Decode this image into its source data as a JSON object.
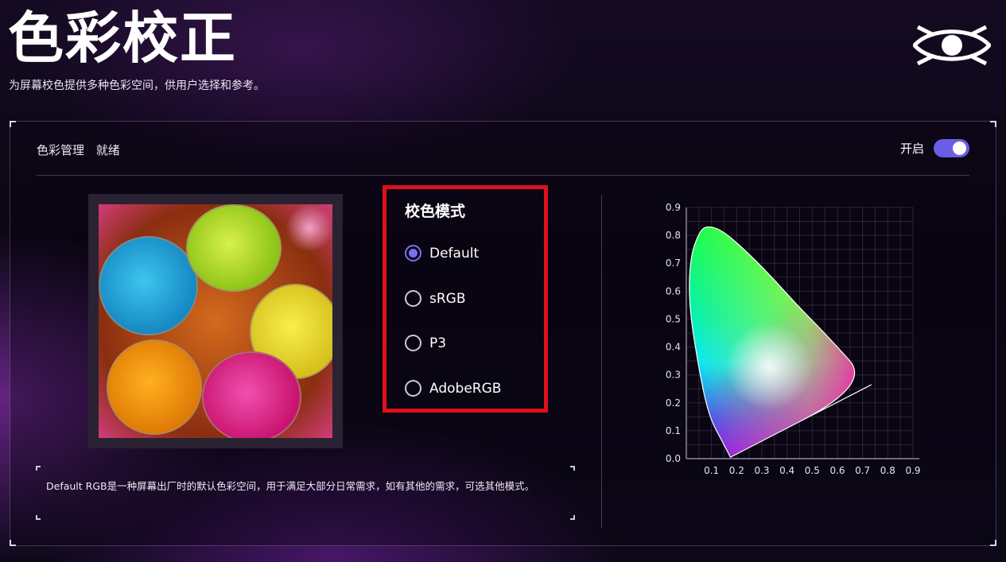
{
  "header": {
    "title": "色彩校正",
    "subtitle": "为屏幕校色提供多种色彩空间，供用户选择和参考。",
    "logo_icon": "eye-logo-icon"
  },
  "panel": {
    "status_label": "色彩管理",
    "status_value": "就绪",
    "toggle_label": "开启",
    "toggle_on": true,
    "accent_color": "#6b5ee6"
  },
  "mode": {
    "title": "校色模式",
    "options": [
      {
        "label": "Default",
        "selected": true
      },
      {
        "label": "sRGB",
        "selected": false
      },
      {
        "label": "P3",
        "selected": false
      },
      {
        "label": "AdobeRGB",
        "selected": false
      }
    ],
    "highlight_color": "#e0101a"
  },
  "description": "Default RGB是一种屏幕出厂时的默认色彩空间，用于满足大部分日常需求，如有其他的需求，可选其他模式。",
  "chart_data": {
    "type": "scatter",
    "title": "",
    "xlabel": "",
    "ylabel": "",
    "x_ticks": [
      "0.1",
      "0.2",
      "0.3",
      "0.4",
      "0.5",
      "0.6",
      "0.7",
      "0.8",
      "0.9"
    ],
    "y_ticks": [
      "0.0",
      "0.1",
      "0.2",
      "0.3",
      "0.4",
      "0.5",
      "0.6",
      "0.7",
      "0.8",
      "0.9"
    ],
    "xlim": [
      0.0,
      0.9
    ],
    "ylim": [
      0.0,
      0.9
    ],
    "grid": true,
    "series": [
      {
        "values": [
          [
            0.175,
            0.005
          ],
          [
            0.15,
            0.05
          ],
          [
            0.09,
            0.15
          ],
          [
            0.05,
            0.32
          ],
          [
            0.01,
            0.55
          ],
          [
            0.015,
            0.72
          ],
          [
            0.05,
            0.81
          ],
          [
            0.08,
            0.835
          ],
          [
            0.14,
            0.82
          ],
          [
            0.23,
            0.75
          ],
          [
            0.33,
            0.66
          ],
          [
            0.44,
            0.55
          ],
          [
            0.56,
            0.44
          ],
          [
            0.735,
            0.265
          ],
          [
            0.175,
            0.005
          ]
        ]
      }
    ]
  }
}
